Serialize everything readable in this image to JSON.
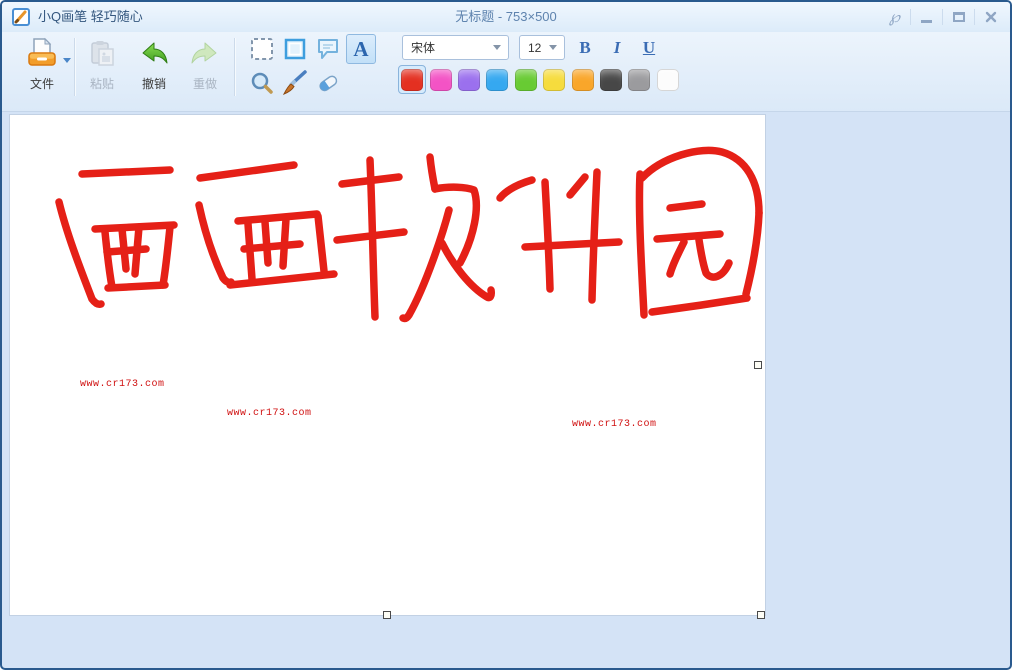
{
  "window": {
    "app_title": "小Q画笔 轻巧随心",
    "doc_title": "无标题 - 753×500",
    "feedback_glyph": "℘"
  },
  "toolbar": {
    "file_label": "文件",
    "paste_label": "粘贴",
    "undo_label": "撤销",
    "redo_label": "重做",
    "text_tool_glyph": "A",
    "font_family": "宋体",
    "font_size": "12",
    "bold_label": "B",
    "italic_label": "I",
    "underline_label": "U",
    "colors": [
      {
        "name": "red",
        "hex": "#e43021",
        "selected": true
      },
      {
        "name": "magenta",
        "hex": "#f353c5",
        "selected": false
      },
      {
        "name": "purple",
        "hex": "#9b70ee",
        "selected": false
      },
      {
        "name": "blue",
        "hex": "#35a8f0",
        "selected": false
      },
      {
        "name": "green",
        "hex": "#68cb33",
        "selected": false
      },
      {
        "name": "yellow",
        "hex": "#f6dc3d",
        "selected": false
      },
      {
        "name": "orange",
        "hex": "#f9a62a",
        "selected": false
      },
      {
        "name": "dark-gray",
        "hex": "#474747",
        "selected": false
      },
      {
        "name": "gray",
        "hex": "#9b9b9e",
        "selected": false
      },
      {
        "name": "white",
        "hex": "#fcfcfc",
        "selected": false
      }
    ]
  },
  "canvas": {
    "drawing_text": "西西软件园",
    "stroke_color": "#e52017",
    "strokes": [
      "M72,59 L160,55",
      "M49,87 C57,120 72,158 82,184 C85,188 88,190 91,189",
      "M85,114 L164,110",
      "M95,117 C97,137 99,155 102,172",
      "M98,173 L155,170",
      "M160,112 C158,132 156,152 153,170",
      "M112,114 L116,154",
      "M129,112 L125,159",
      "M97,137 L136,134",
      "M190,63 L284,50",
      "M189,90 C195,118 204,144 213,163 C216,167 219,168 221,167",
      "M228,106 L307,99",
      "M238,109 L242,164",
      "M255,107 L258,148",
      "M276,104 L273,151",
      "M234,134 L290,129",
      "M308,101 L314,156",
      "M220,170 L324,159",
      "M332,69 L389,62",
      "M360,45 C362,90 363,150 365,202",
      "M327,125 L394,117",
      "M420,42 C421,52 423,64 425,74",
      "M425,74 C440,71 456,72 464,75 C470,92 464,122 450,148",
      "M439,95 C433,118 416,170 399,200 C397,203 395,204 393,203",
      "M432,128 C443,150 460,172 477,182 C480,184 482,181 481,175",
      "M490,83 C495,77 505,70 522,65",
      "M535,67 C537,103 539,140 540,174",
      "M560,80 C565,74 570,68 575,62",
      "M587,57 C585,100 583,142 582,185",
      "M515,132 L609,127",
      "M630,59 C628,98 632,160 634,200",
      "M632,63 C652,42 690,31 712,37 C736,44 749,66 749,98",
      "M749,98 C748,124 742,155 736,179",
      "M642,197 C672,193 706,188 737,183",
      "M660,93 L692,89",
      "M647,124 L710,119",
      "M674,127 C668,139 663,149 660,159",
      "M689,125 C691,138 693,149 696,158 C702,166 713,162 719,148"
    ],
    "watermarks": [
      {
        "text": "www.cr173.com"
      },
      {
        "text": "www.cr173.com"
      },
      {
        "text": "www.cr173.com"
      }
    ]
  }
}
